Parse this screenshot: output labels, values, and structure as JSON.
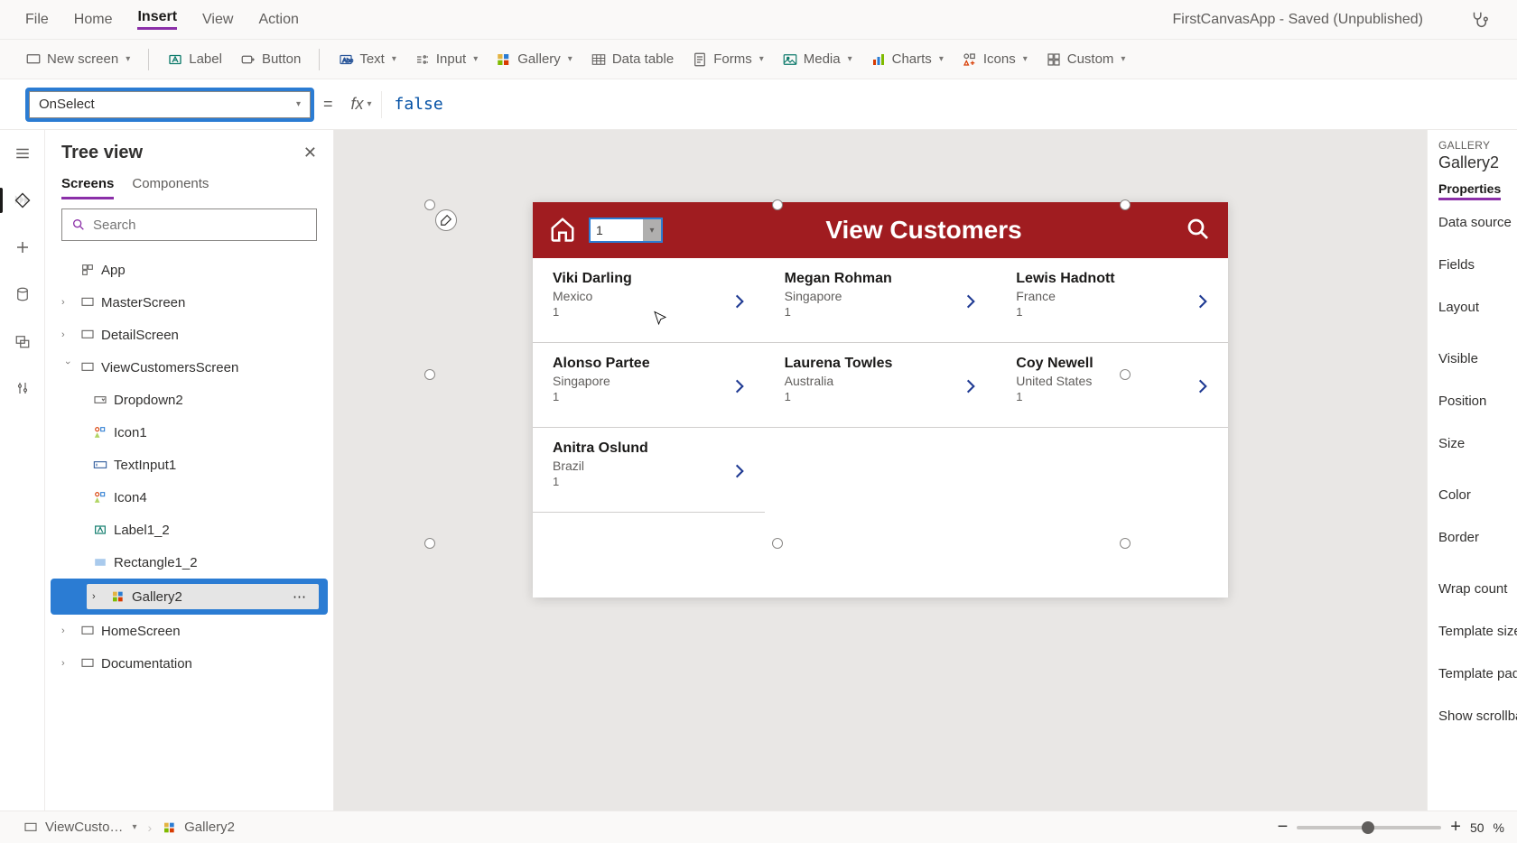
{
  "topMenu": {
    "items": [
      "File",
      "Home",
      "Insert",
      "View",
      "Action"
    ],
    "active": "Insert"
  },
  "appTitle": "FirstCanvasApp - Saved (Unpublished)",
  "ribbon": {
    "newScreen": "New screen",
    "label": "Label",
    "button": "Button",
    "text": "Text",
    "input": "Input",
    "gallery": "Gallery",
    "dataTable": "Data table",
    "forms": "Forms",
    "media": "Media",
    "charts": "Charts",
    "icons": "Icons",
    "custom": "Custom"
  },
  "property": {
    "selected": "OnSelect",
    "equals": "=",
    "fx": "fx",
    "formula": "false"
  },
  "treeView": {
    "title": "Tree view",
    "tabs": {
      "screens": "Screens",
      "components": "Components"
    },
    "searchPlaceholder": "Search",
    "app": "App",
    "nodes": {
      "master": "MasterScreen",
      "detail": "DetailScreen",
      "viewCust": "ViewCustomersScreen",
      "dropdown2": "Dropdown2",
      "icon1": "Icon1",
      "textInput1": "TextInput1",
      "icon4": "Icon4",
      "label1_2": "Label1_2",
      "rect1_2": "Rectangle1_2",
      "gallery2": "Gallery2",
      "home": "HomeScreen",
      "doc": "Documentation"
    }
  },
  "canvas": {
    "headerTitle": "View Customers",
    "dropdownValue": "1",
    "customers": [
      {
        "name": "Viki  Darling",
        "country": "Mexico",
        "num": "1"
      },
      {
        "name": "Megan  Rohman",
        "country": "Singapore",
        "num": "1"
      },
      {
        "name": "Lewis  Hadnott",
        "country": "France",
        "num": "1"
      },
      {
        "name": "Alonso  Partee",
        "country": "Singapore",
        "num": "1"
      },
      {
        "name": "Laurena  Towles",
        "country": "Australia",
        "num": "1"
      },
      {
        "name": "Coy  Newell",
        "country": "United States",
        "num": "1"
      },
      {
        "name": "Anitra  Oslund",
        "country": "Brazil",
        "num": "1"
      }
    ]
  },
  "props": {
    "sectionLabel": "GALLERY",
    "selectedName": "Gallery2",
    "tab": "Properties",
    "rows": [
      "Data source",
      "Fields",
      "Layout",
      "Visible",
      "Position",
      "Size",
      "Color",
      "Border",
      "Wrap count",
      "Template size",
      "Template padd",
      "Show scrollba"
    ]
  },
  "status": {
    "breadcrumb1": "ViewCusto…",
    "breadcrumb2": "Gallery2",
    "zoomValue": "50",
    "zoomPct": "%"
  }
}
